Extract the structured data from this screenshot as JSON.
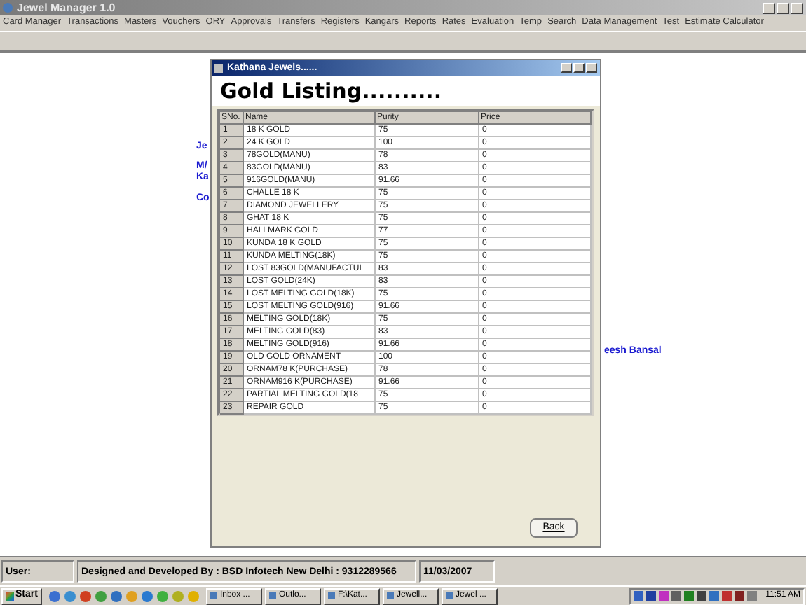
{
  "window": {
    "title": "Jewel Manager 1.0"
  },
  "menu": [
    "Card Manager",
    "Transactions",
    "Masters",
    "Vouchers",
    "ORY",
    "Approvals",
    "Transfers",
    "Registers",
    "Kangars",
    "Reports",
    "Rates",
    "Evaluation",
    "Temp",
    "Search",
    "Data Management",
    "Test",
    "Estimate Calculator"
  ],
  "background_texts": [
    "Je",
    "M/",
    "Ka",
    "Co",
    "eesh Bansal"
  ],
  "dialog": {
    "title": "Kathana Jewels......",
    "heading": "Gold Listing..........",
    "table": {
      "columns": [
        "SNo.",
        "Name",
        "Purity",
        "Price"
      ],
      "rows": [
        [
          "1",
          "18 K GOLD",
          "75",
          "0"
        ],
        [
          "2",
          "24 K GOLD",
          "100",
          "0"
        ],
        [
          "3",
          "78GOLD(MANU)",
          "78",
          "0"
        ],
        [
          "4",
          "83GOLD(MANU)",
          "83",
          "0"
        ],
        [
          "5",
          "916GOLD(MANU)",
          "91.66",
          "0"
        ],
        [
          "6",
          "CHALLE 18 K",
          "75",
          "0"
        ],
        [
          "7",
          "DIAMOND JEWELLERY",
          "75",
          "0"
        ],
        [
          "8",
          "GHAT 18 K",
          "75",
          "0"
        ],
        [
          "9",
          "HALLMARK GOLD",
          "77",
          "0"
        ],
        [
          "10",
          "KUNDA 18 K GOLD",
          "75",
          "0"
        ],
        [
          "11",
          "KUNDA MELTING(18K)",
          "75",
          "0"
        ],
        [
          "12",
          "LOST 83GOLD(MANUFACTUI",
          "83",
          "0"
        ],
        [
          "13",
          "LOST GOLD(24K)",
          "83",
          "0"
        ],
        [
          "14",
          "LOST MELTING GOLD(18K)",
          "75",
          "0"
        ],
        [
          "15",
          "LOST MELTING GOLD(916)",
          "91.66",
          "0"
        ],
        [
          "16",
          "MELTING GOLD(18K)",
          "75",
          "0"
        ],
        [
          "17",
          "MELTING GOLD(83)",
          "83",
          "0"
        ],
        [
          "18",
          "MELTING GOLD(916)",
          "91.66",
          "0"
        ],
        [
          "19",
          "OLD GOLD ORNAMENT",
          "100",
          "0"
        ],
        [
          "20",
          "ORNAM78 K(PURCHASE)",
          "78",
          "0"
        ],
        [
          "21",
          "ORNAM916 K(PURCHASE)",
          "91.66",
          "0"
        ],
        [
          "22",
          "PARTIAL MELTING GOLD(18",
          "75",
          "0"
        ],
        [
          "23",
          "REPAIR GOLD",
          "75",
          "0"
        ]
      ]
    },
    "back_button": "Back"
  },
  "status_bar": [
    "User:",
    "Designed and Developed By : BSD Infotech New Delhi : 9312289566",
    "11/03/2007"
  ],
  "taskbar": {
    "start": "Start",
    "tasks": [
      "Inbox ...",
      "Outlo...",
      "F:\\Kat...",
      "Jewell...",
      "Jewel ..."
    ],
    "clock": "11:51 AM"
  }
}
